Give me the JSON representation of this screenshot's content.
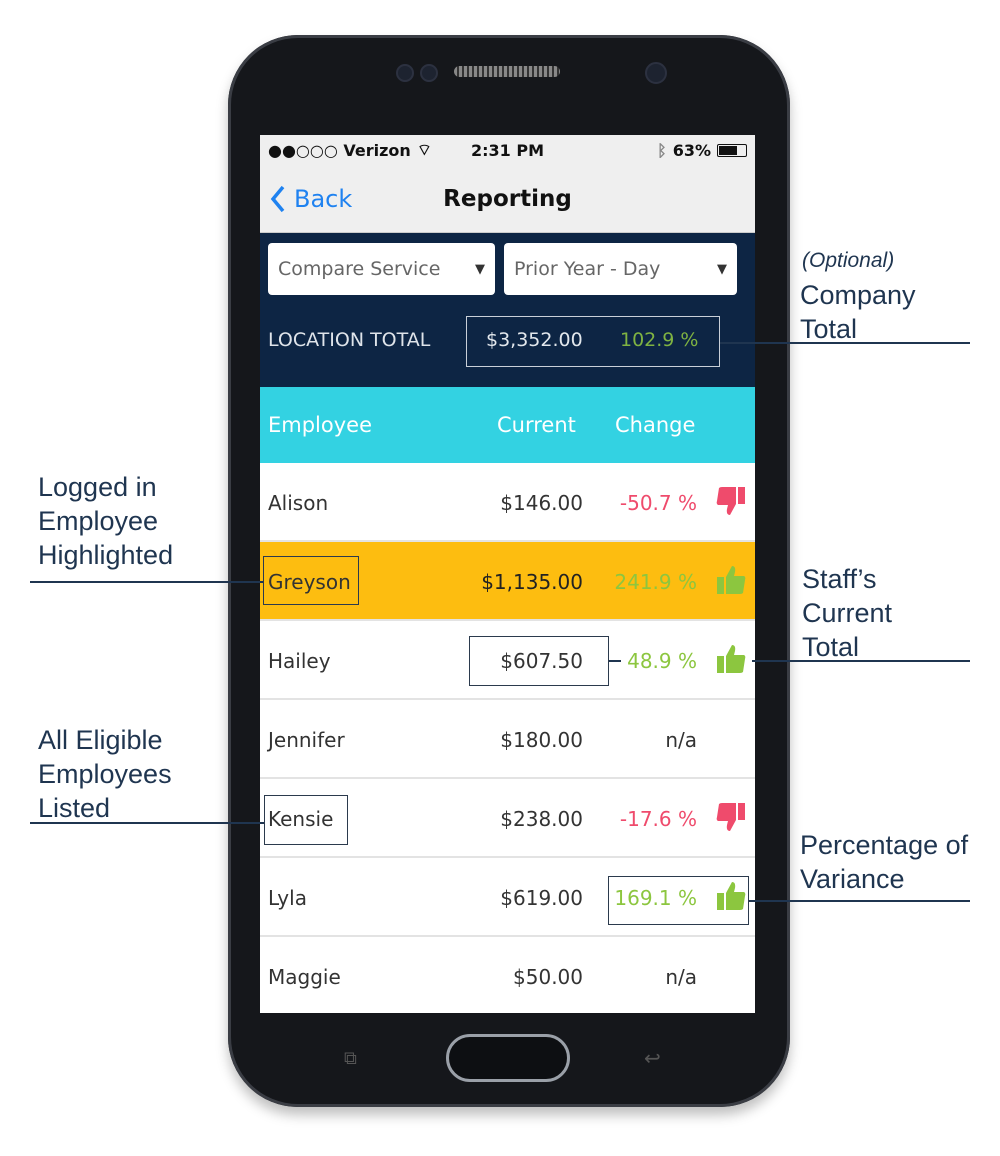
{
  "status_bar": {
    "carrier": "●●○○○ Verizon",
    "time": "2:31 PM",
    "battery": "63%",
    "battery_level": 0.63
  },
  "nav": {
    "back_label": "Back",
    "title": "Reporting"
  },
  "filters": {
    "service": "Compare Service",
    "period": "Prior Year - Day"
  },
  "location_total": {
    "label": "LOCATION TOTAL",
    "amount": "$3,352.00",
    "change": "102.9 %"
  },
  "table": {
    "headers": [
      "Employee",
      "Current",
      "Change"
    ],
    "rows": [
      {
        "name": "Alison",
        "current": "$146.00",
        "change": "-50.7 %",
        "trend": "down"
      },
      {
        "name": "Greyson",
        "current": "$1,135.00",
        "change": "241.9 %",
        "trend": "up",
        "highlighted": true
      },
      {
        "name": "Hailey",
        "current": "$607.50",
        "change": "48.9 %",
        "trend": "up"
      },
      {
        "name": "Jennifer",
        "current": "$180.00",
        "change": "n/a",
        "trend": "none"
      },
      {
        "name": "Kensie",
        "current": "$238.00",
        "change": "-17.6 %",
        "trend": "down"
      },
      {
        "name": "Lyla",
        "current": "$619.00",
        "change": "169.1 %",
        "trend": "up"
      },
      {
        "name": "Maggie",
        "current": "$50.00",
        "change": "n/a",
        "trend": "none"
      }
    ]
  },
  "annotations": {
    "optional": "(Optional)",
    "company_total": "Company Total",
    "logged_in": "Logged in Employee Highlighted",
    "staff_total": "Staff’s Current Total",
    "all_eligible": "All Eligible Employees Listed",
    "variance": "Percentage of Variance"
  },
  "colors": {
    "accent": "#33d2e2",
    "panel": "#0d2544",
    "highlight": "#fdbd10",
    "positive": "#8cc63f",
    "negative": "#ef4b6c",
    "link": "#1f82f0"
  }
}
